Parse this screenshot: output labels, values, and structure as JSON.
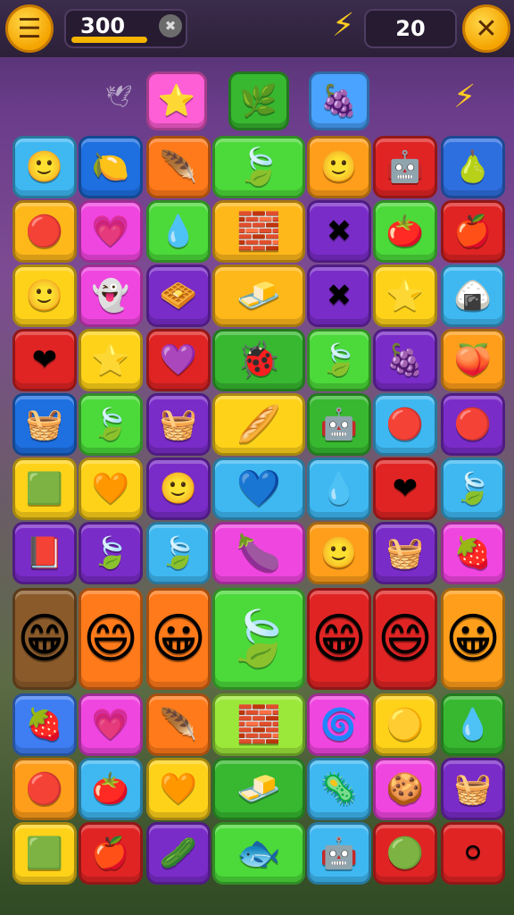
{
  "hud": {
    "menu_icon": "hamburger-menu-icon",
    "score": "300",
    "score_progress": 0.85,
    "moves": "20",
    "close_icon": "close-icon",
    "bolt_icon": "lightning-bolt-icon"
  },
  "targets": [
    {
      "icon": "star-candy-icon",
      "color": "#ff5fd6",
      "glyph": "⭐"
    },
    {
      "icon": "green-leaf-icon",
      "color": "#37b830",
      "glyph": "🌿"
    },
    {
      "icon": "purple-berry-icon",
      "color": "#4aa3ff",
      "glyph": "🍇"
    }
  ],
  "board": {
    "tiles": [
      {
        "id": "r1c1",
        "color": "#3fb8f2",
        "glyph": "🙂",
        "icon": "pink-ball-icon"
      },
      {
        "id": "r1c2",
        "color": "#1e6fe0",
        "glyph": "🍋",
        "icon": "lemon-icon"
      },
      {
        "id": "r1c3",
        "color": "#ff7a1a",
        "glyph": "🪶",
        "icon": "feather-icon"
      },
      {
        "id": "r1c4",
        "color": "#4cd93a",
        "glyph": "🍃",
        "icon": "leaf-icon",
        "wide": true
      },
      {
        "id": "r1c5",
        "color": "#ff9e1a",
        "glyph": "🙂",
        "icon": "yellow-face-icon"
      },
      {
        "id": "r1c6",
        "color": "#e02424",
        "glyph": "🤖",
        "icon": "blue-robot-icon"
      },
      {
        "id": "r1c7",
        "color": "#2e6fe0",
        "glyph": "🍐",
        "icon": "green-pear-icon"
      },
      {
        "id": "r2c1",
        "color": "#ffb81a",
        "glyph": "🔴",
        "icon": "red-ball-icon"
      },
      {
        "id": "r2c2",
        "color": "#f046e0",
        "glyph": "💗",
        "icon": "pink-heart-icon"
      },
      {
        "id": "r2c3",
        "color": "#4cd93a",
        "glyph": "💧",
        "icon": "blue-drop-icon"
      },
      {
        "id": "r2c4",
        "color": "#ffb81a",
        "glyph": "🧱",
        "icon": "red-brick-icon",
        "wide": true
      },
      {
        "id": "r2c5",
        "color": "#7a2cc8",
        "glyph": "✖",
        "icon": "crossed-sticks-icon"
      },
      {
        "id": "r2c6",
        "color": "#4cd93a",
        "glyph": "🍅",
        "icon": "tomato-icon"
      },
      {
        "id": "r2c7",
        "color": "#e02424",
        "glyph": "🍎",
        "icon": "apple-icon"
      },
      {
        "id": "r3c1",
        "color": "#ffd21a",
        "glyph": "🙂",
        "icon": "yellow-face-icon"
      },
      {
        "id": "r3c2",
        "color": "#f046e0",
        "glyph": "👻",
        "icon": "white-ghost-icon"
      },
      {
        "id": "r3c3",
        "color": "#7a2cc8",
        "glyph": "🧇",
        "icon": "toast-block-icon"
      },
      {
        "id": "r3c4",
        "color": "#ffb81a",
        "glyph": "🧈",
        "icon": "orange-brick-icon",
        "wide": true
      },
      {
        "id": "r3c5",
        "color": "#7a2cc8",
        "glyph": "✖",
        "icon": "crossed-sticks-icon"
      },
      {
        "id": "r3c6",
        "color": "#ffd21a",
        "glyph": "⭐",
        "icon": "yellow-star-icon"
      },
      {
        "id": "r3c7",
        "color": "#3fb8f2",
        "glyph": "🍙",
        "icon": "rice-ball-icon"
      },
      {
        "id": "r4c1",
        "color": "#e02424",
        "glyph": "❤",
        "icon": "red-heart-icon"
      },
      {
        "id": "r4c2",
        "color": "#ffd21a",
        "glyph": "⭐",
        "icon": "yellow-star-icon"
      },
      {
        "id": "r4c3",
        "color": "#e02424",
        "glyph": "💜",
        "icon": "purple-heart-icon"
      },
      {
        "id": "r4c4",
        "color": "#37b830",
        "glyph": "🐞",
        "icon": "red-bug-icon",
        "wide": true
      },
      {
        "id": "r4c5",
        "color": "#4cd93a",
        "glyph": "🍃",
        "icon": "leaf-icon"
      },
      {
        "id": "r4c6",
        "color": "#7a2cc8",
        "glyph": "🍇",
        "icon": "grapes-icon"
      },
      {
        "id": "r4c7",
        "color": "#ff9e1a",
        "glyph": "🍑",
        "icon": "peach-icon"
      },
      {
        "id": "r5c1",
        "color": "#1e6fe0",
        "glyph": "🧺",
        "icon": "pink-bucket-icon"
      },
      {
        "id": "r5c2",
        "color": "#4cd93a",
        "glyph": "🍃",
        "icon": "green-leaf-icon"
      },
      {
        "id": "r5c3",
        "color": "#7a2cc8",
        "glyph": "🧺",
        "icon": "blue-bucket-icon"
      },
      {
        "id": "r5c4",
        "color": "#ffd21a",
        "glyph": "🥖",
        "icon": "bread-icon",
        "wide": true
      },
      {
        "id": "r5c5",
        "color": "#37b830",
        "glyph": "🤖",
        "icon": "cyan-robot-icon"
      },
      {
        "id": "r5c6",
        "color": "#3fb8f2",
        "glyph": "🔴",
        "icon": "red-ball-icon"
      },
      {
        "id": "r5c7",
        "color": "#7a2cc8",
        "glyph": "🔴",
        "icon": "red-ball-icon"
      },
      {
        "id": "r6c1",
        "color": "#ffd21a",
        "glyph": "🟩",
        "icon": "green-block-face-icon"
      },
      {
        "id": "r6c2",
        "color": "#ffd21a",
        "glyph": "🧡",
        "icon": "orange-heart-icon"
      },
      {
        "id": "r6c3",
        "color": "#7a2cc8",
        "glyph": "🙂",
        "icon": "yellow-face-icon"
      },
      {
        "id": "r6c4",
        "color": "#3fb8f2",
        "glyph": "💙",
        "icon": "blue-heart-icon",
        "wide": true
      },
      {
        "id": "r6c5",
        "color": "#3fb8f2",
        "glyph": "💧",
        "icon": "blue-drop-icon"
      },
      {
        "id": "r6c6",
        "color": "#e02424",
        "glyph": "❤",
        "icon": "red-heart-icon"
      },
      {
        "id": "r6c7",
        "color": "#3fb8f2",
        "glyph": "🍃",
        "icon": "green-leaf-icon"
      },
      {
        "id": "r7c1",
        "color": "#7a2cc8",
        "glyph": "📕",
        "icon": "book-icon"
      },
      {
        "id": "r7c2",
        "color": "#7a2cc8",
        "glyph": "🍃",
        "icon": "leaf-icon"
      },
      {
        "id": "r7c3",
        "color": "#3fb8f2",
        "glyph": "🍃",
        "icon": "leaf-icon"
      },
      {
        "id": "r7c4",
        "color": "#f046e0",
        "glyph": "🍆",
        "icon": "purple-bar-icon",
        "wide": true
      },
      {
        "id": "r7c5",
        "color": "#ff9e1a",
        "glyph": "🙂",
        "icon": "yellow-face-icon"
      },
      {
        "id": "r7c6",
        "color": "#7a2cc8",
        "glyph": "🧺",
        "icon": "blue-bucket-icon"
      },
      {
        "id": "r7c7",
        "color": "#f046e0",
        "glyph": "🍓",
        "icon": "strawberry-icon"
      }
    ],
    "tall_tiles": [
      {
        "id": "t1",
        "color": "#8a5a2a",
        "glyph": "😁",
        "icon": "yellow-character-icon"
      },
      {
        "id": "t2",
        "color": "#ff7a1a",
        "glyph": "😄",
        "icon": "brown-character-icon"
      },
      {
        "id": "t3",
        "color": "#ff7a1a",
        "glyph": "😀",
        "icon": "orange-character-icon"
      },
      {
        "id": "t4",
        "color": "#4cd93a",
        "glyph": "🍃",
        "icon": "big-leaf-icon"
      },
      {
        "id": "t5",
        "color": "#e02424",
        "glyph": "😁",
        "icon": "purple-character-icon"
      },
      {
        "id": "t6",
        "color": "#e02424",
        "glyph": "😄",
        "icon": "green-character-icon"
      },
      {
        "id": "t7",
        "color": "#ff9e1a",
        "glyph": "😀",
        "icon": "orange-character-icon"
      }
    ],
    "bottom_tiles": [
      {
        "id": "b1c1",
        "color": "#3f7ef2",
        "glyph": "🍓",
        "icon": "red-berry-icon"
      },
      {
        "id": "b1c2",
        "color": "#f046e0",
        "glyph": "💗",
        "icon": "pink-heart-icon"
      },
      {
        "id": "b1c3",
        "color": "#ff7a1a",
        "glyph": "🪶",
        "icon": "feather-icon"
      },
      {
        "id": "b1c4",
        "color": "#9ce83a",
        "glyph": "🧱",
        "icon": "red-brick-icon",
        "wide": true
      },
      {
        "id": "b1c5",
        "color": "#f046e0",
        "glyph": "🌀",
        "icon": "purple-swirl-icon"
      },
      {
        "id": "b1c6",
        "color": "#ffd21a",
        "glyph": "🟡",
        "icon": "yellow-ball-icon"
      },
      {
        "id": "b1c7",
        "color": "#37b830",
        "glyph": "💧",
        "icon": "blue-drop-icon"
      },
      {
        "id": "b2c1",
        "color": "#ff9e1a",
        "glyph": "🔴",
        "icon": "red-ball-icon"
      },
      {
        "id": "b2c2",
        "color": "#3fb8f2",
        "glyph": "🍅",
        "icon": "tomato-face-icon"
      },
      {
        "id": "b2c3",
        "color": "#ffd21a",
        "glyph": "🧡",
        "icon": "orange-heart-icon"
      },
      {
        "id": "b2c4",
        "color": "#37b830",
        "glyph": "🧈",
        "icon": "butter-icon",
        "wide": true
      },
      {
        "id": "b2c5",
        "color": "#3fb8f2",
        "glyph": "🦠",
        "icon": "purple-germ-icon"
      },
      {
        "id": "b2c6",
        "color": "#f046e0",
        "glyph": "🍪",
        "icon": "cookie-block-icon"
      },
      {
        "id": "b2c7",
        "color": "#7a2cc8",
        "glyph": "🧺",
        "icon": "pink-bucket-icon"
      },
      {
        "id": "b3c1",
        "color": "#ffd21a",
        "glyph": "🟩",
        "icon": "green-block-face-icon"
      },
      {
        "id": "b3c2",
        "color": "#e02424",
        "glyph": "🍎",
        "icon": "pink-apple-icon"
      },
      {
        "id": "b3c3",
        "color": "#7a2cc8",
        "glyph": "🥒",
        "icon": "green-cucumber-icon"
      },
      {
        "id": "b3c4",
        "color": "#4cd93a",
        "glyph": "🐟",
        "icon": "blue-fish-icon",
        "wide": true
      },
      {
        "id": "b3c5",
        "color": "#3fb8f2",
        "glyph": "🤖",
        "icon": "blue-robot-icon"
      },
      {
        "id": "b3c6",
        "color": "#e02424",
        "glyph": "🟢",
        "icon": "green-ball-icon"
      },
      {
        "id": "b3c7",
        "color": "#e02424",
        "glyph": "⚪",
        "icon": "white-dotted-ball-icon"
      }
    ]
  }
}
